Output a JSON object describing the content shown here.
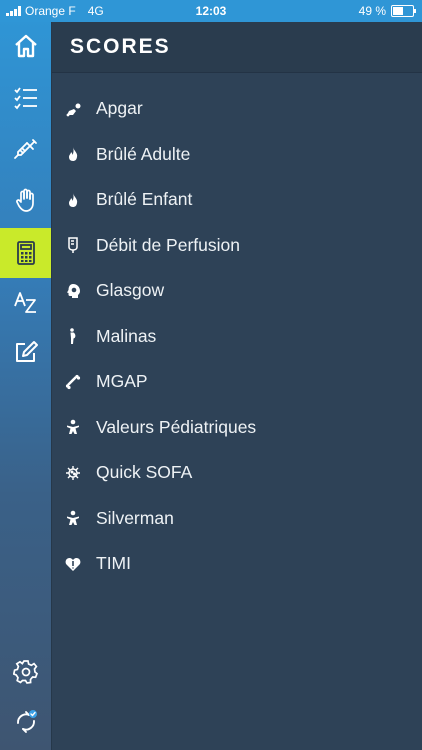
{
  "status_bar": {
    "carrier": "Orange F",
    "network": "4G",
    "time": "12:03",
    "battery": "49 %"
  },
  "sidebar": {
    "items": [
      {
        "icon": "home-icon",
        "active": false
      },
      {
        "icon": "checklist-icon",
        "active": false
      },
      {
        "icon": "syringe-icon",
        "active": false
      },
      {
        "icon": "hand-icon",
        "active": false
      },
      {
        "icon": "calculator-icon",
        "active": true
      },
      {
        "icon": "a-z-icon",
        "active": false
      },
      {
        "icon": "edit-icon",
        "active": false
      },
      {
        "icon": "gear-icon",
        "active": false
      },
      {
        "icon": "sync-icon",
        "active": false
      }
    ],
    "active_color": "#c9ea2a"
  },
  "header": {
    "title": "SCORES"
  },
  "scores": [
    {
      "label": "Apgar",
      "icon": "baby-crawl-icon"
    },
    {
      "label": "Brûlé Adulte",
      "icon": "flame-icon"
    },
    {
      "label": "Brûlé Enfant",
      "icon": "flame-icon"
    },
    {
      "label": "Débit de Perfusion",
      "icon": "iv-bag-icon"
    },
    {
      "label": "Glasgow",
      "icon": "head-brain-icon"
    },
    {
      "label": "Malinas",
      "icon": "pregnant-icon"
    },
    {
      "label": "MGAP",
      "icon": "bone-icon"
    },
    {
      "label": "Valeurs Pédiatriques",
      "icon": "child-icon"
    },
    {
      "label": "Quick SOFA",
      "icon": "virus-icon"
    },
    {
      "label": "Silverman",
      "icon": "child-icon"
    },
    {
      "label": "TIMI",
      "icon": "heart-icon"
    }
  ]
}
